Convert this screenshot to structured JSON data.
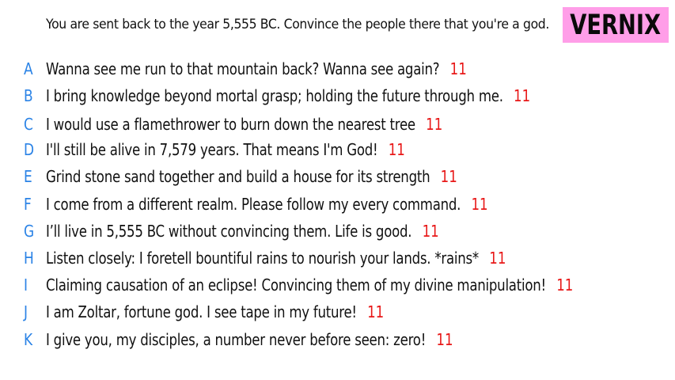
{
  "prompt": "You are sent back to the year 5,555 BC. Convince the people there that you're a god.",
  "logo": "VERNIX",
  "answers": [
    {
      "letter": "A",
      "text": "Wanna see me run to that mountain back? Wanna see again?",
      "score": "11"
    },
    {
      "letter": "B",
      "text": "I bring knowledge beyond mortal grasp; holding the future through me.",
      "score": "11"
    },
    {
      "letter": "C",
      "text": "I would use a flamethrower to burn down the nearest tree",
      "score": "11"
    },
    {
      "letter": "D",
      "text": "I'll still be alive in 7,579 years. That means I'm God!",
      "score": "11"
    },
    {
      "letter": "E",
      "text": "Grind stone sand together and build a house for its strength",
      "score": "11"
    },
    {
      "letter": "F",
      "text": "I come from a different realm. Please follow my every command.",
      "score": "11"
    },
    {
      "letter": "G",
      "text": "I’ll live in 5,555 BC without convincing them. Life is good.",
      "score": "11"
    },
    {
      "letter": "H",
      "text": "Listen closely: I foretell bountiful rains to nourish your lands. *rains*",
      "score": "11"
    },
    {
      "letter": "I",
      "text": "Claiming causation of an eclipse! Convincing them of my divine manipulation!",
      "score": "11"
    },
    {
      "letter": "J",
      "text": "I am Zoltar, fortune god. I see tape in my future!",
      "score": "11"
    },
    {
      "letter": "K",
      "text": "I give you, my disciples, a number never before seen: zero!",
      "score": "11"
    }
  ],
  "colors": {
    "letter": "#2b83e6",
    "score": "#e81818",
    "logo_bg": "#ff9ee8"
  }
}
